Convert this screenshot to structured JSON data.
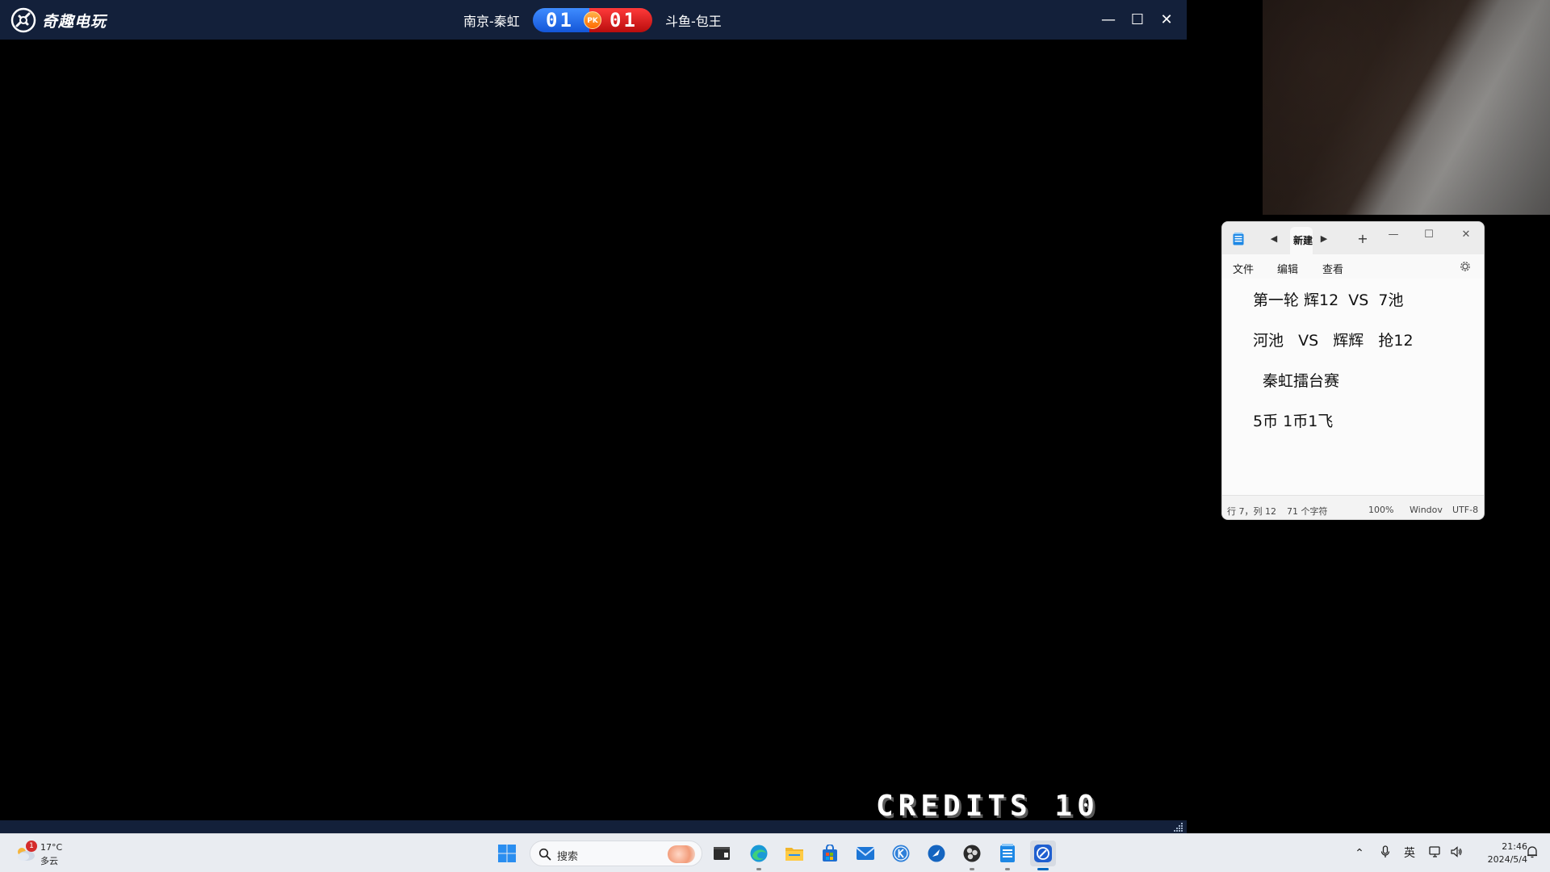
{
  "game": {
    "app_name": "奇趣电玩",
    "player_left": "南京-秦虹",
    "player_right": "斗鱼-包王",
    "score_left": "01",
    "score_right": "01",
    "pk_label": "PK",
    "credits": "CREDITS 10",
    "window_controls": {
      "minimize": "—",
      "maximize": "☐",
      "close": "✕"
    }
  },
  "notepad": {
    "tab_title": "新建",
    "add_tab": "+",
    "menus": {
      "file": "文件",
      "edit": "编辑",
      "view": "查看"
    },
    "lines": [
      "第一轮 辉12  VS  7池",
      "河池   VS   辉辉   抢12",
      "秦虹擂台赛",
      "5币 1币1飞"
    ],
    "status": {
      "position": "行 7，列 12",
      "chars": "71 个字符",
      "zoom": "100%",
      "eol": "Windov",
      "encoding": "UTF-8"
    }
  },
  "taskbar": {
    "weather_badge": "1",
    "weather_temp": "17°C",
    "weather_desc": "多云",
    "search_placeholder": "搜索",
    "ime": "英",
    "clock_time": "21:46",
    "clock_date": "2024/5/4"
  },
  "colors": {
    "game_titlebar": "#13203a",
    "score_blue": "#1456d8",
    "score_red": "#b90d0d",
    "taskbar": "#e9ecf1",
    "accent": "#0067c0"
  }
}
